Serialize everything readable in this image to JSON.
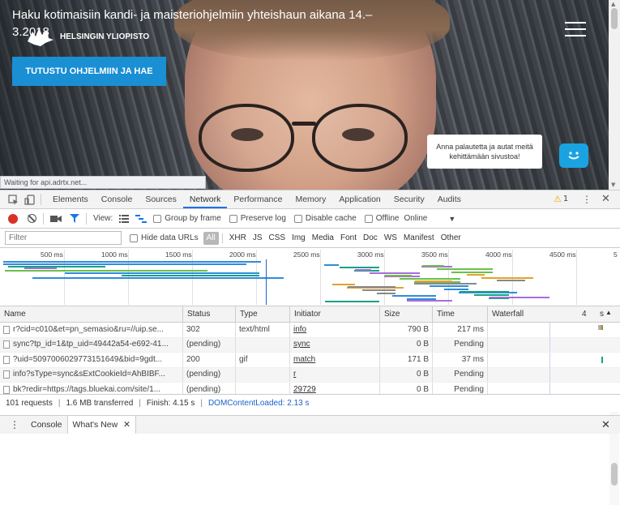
{
  "page": {
    "hero_title": "Haku kotimaisiin kandi- ja maisteriohjelmiin yhteishaun aikana 14.–​ 3.2018",
    "logo_text": "HELSINGIN YLIOPISTO",
    "cta_label": "TUTUSTU OHJELMIIN JA HAE",
    "feedback_text": "Anna palautetta ja autat meitä kehittämään sivustoa!",
    "status_text": "Waiting for api.adrtx.net...",
    "accent": "#1a8fd4"
  },
  "devtools": {
    "tabs": [
      {
        "label": "Elements"
      },
      {
        "label": "Console"
      },
      {
        "label": "Sources"
      },
      {
        "label": "Network",
        "active": true
      },
      {
        "label": "Performance"
      },
      {
        "label": "Memory"
      },
      {
        "label": "Application"
      },
      {
        "label": "Security"
      },
      {
        "label": "Audits"
      }
    ],
    "warning_count": "1",
    "toolbar": {
      "view_label": "View:",
      "group_by_frame": "Group by frame",
      "preserve_log": "Preserve log",
      "disable_cache": "Disable cache",
      "offline": "Offline",
      "throttle": "Online"
    },
    "filter": {
      "placeholder": "Filter",
      "hide_data_urls": "Hide data URLs",
      "types": [
        "All",
        "XHR",
        "JS",
        "CSS",
        "Img",
        "Media",
        "Font",
        "Doc",
        "WS",
        "Manifest",
        "Other"
      ]
    },
    "timeline_ticks": [
      "500 ms",
      "1000 ms",
      "1500 ms",
      "2000 ms",
      "2500 ms",
      "3000 ms",
      "3500 ms",
      "4000 ms",
      "4500 ms",
      "5"
    ],
    "columns": [
      "Name",
      "Status",
      "Type",
      "Initiator",
      "Size",
      "Time",
      "Waterfall",
      "4",
      "s"
    ],
    "rows": [
      {
        "name": "r?cid=c010&et=pn_semasio&ru=//uip.se...",
        "status": "302",
        "type": "text/html",
        "initiator": "info",
        "size": "790 B",
        "time": "217 ms"
      },
      {
        "name": "sync?tp_id=1&tp_uid=49442a54-e692-41...",
        "status": "(pending)",
        "type": "",
        "initiator": "sync",
        "size": "0 B",
        "time": "Pending"
      },
      {
        "name": "?uid=5097006029773151649&bid=9gdt...",
        "status": "200",
        "type": "gif",
        "initiator": "match",
        "size": "171 B",
        "time": "37 ms"
      },
      {
        "name": "info?sType=sync&sExtCookieId=AhBIBF...",
        "status": "(pending)",
        "type": "",
        "initiator": "r",
        "size": "0 B",
        "time": "Pending"
      },
      {
        "name": "bk?redir=https://tags.bluekai.com/site/1...",
        "status": "(pending)",
        "type": "",
        "initiator": "29729",
        "size": "0 B",
        "time": "Pending"
      }
    ],
    "summary": {
      "requests": "101 requests",
      "transferred": "1.6 MB transferred",
      "finish": "Finish: 4.15 s",
      "dcl": "DOMContentLoaded: 2.13 s"
    },
    "drawer": {
      "tabs": [
        "Console",
        "What's New"
      ]
    }
  }
}
